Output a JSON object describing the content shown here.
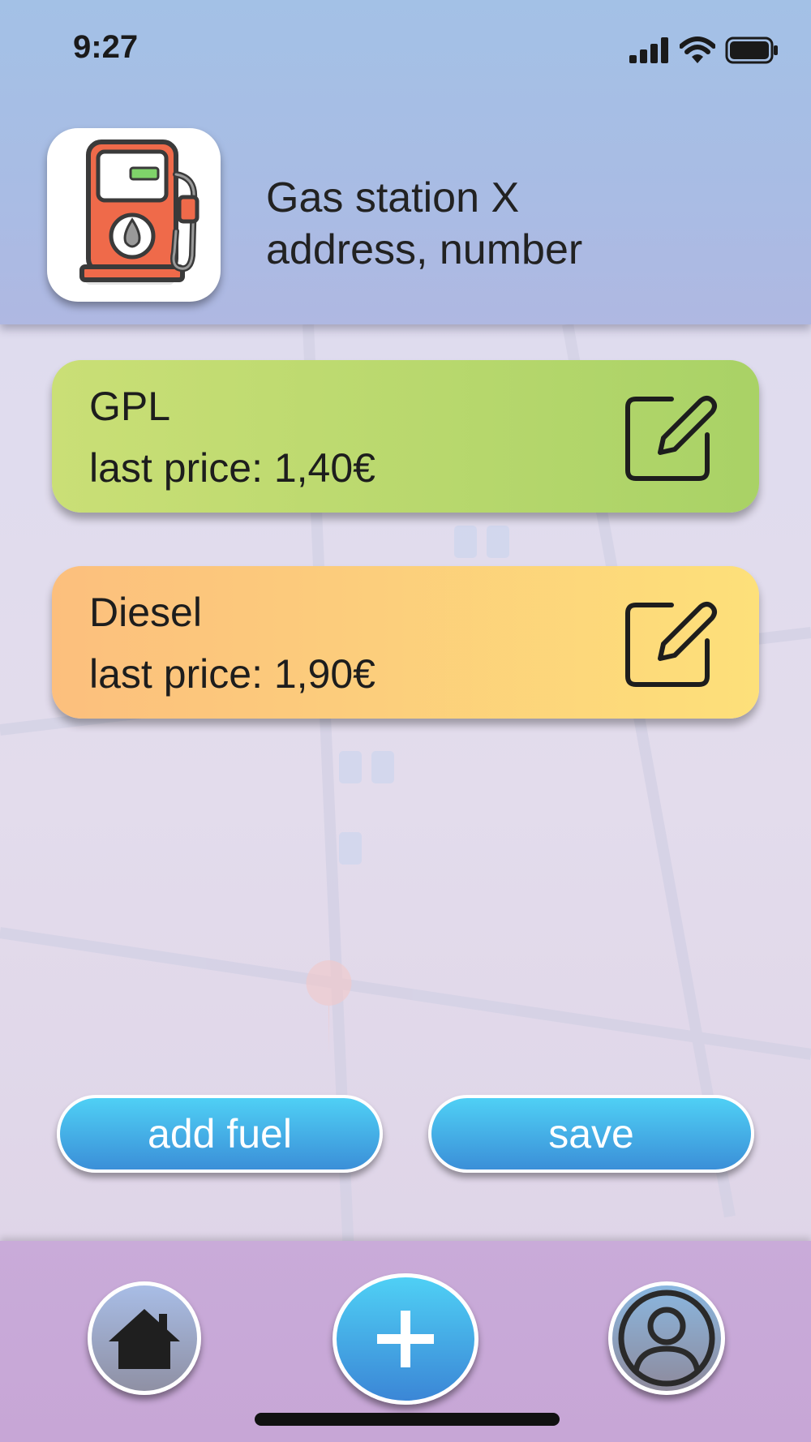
{
  "status_bar": {
    "time": "9:27",
    "icons": [
      "signal-icon",
      "wifi-icon",
      "battery-icon"
    ]
  },
  "header": {
    "app_icon": "gas-pump-icon",
    "station_name": "Gas station X",
    "station_address": "address, number"
  },
  "fuels": [
    {
      "name": "GPL",
      "price_text": "last price: 1,40€",
      "edit_icon": "edit-icon",
      "color_start": "#cadf76",
      "color_end": "#a9d266"
    },
    {
      "name": "Diesel",
      "price_text": "last price: 1,90€",
      "edit_icon": "edit-icon",
      "color_start": "#fcbf7d",
      "color_end": "#fde07a"
    }
  ],
  "actions": {
    "add_fuel_label": "add fuel",
    "save_label": "save"
  },
  "bottom_nav": {
    "items": [
      {
        "icon": "home-icon"
      },
      {
        "icon": "plus-icon"
      },
      {
        "icon": "user-icon"
      }
    ]
  },
  "colors": {
    "accent": "#4fd0f5",
    "header": "#a3c1e6",
    "nav": "#c9abd9"
  }
}
